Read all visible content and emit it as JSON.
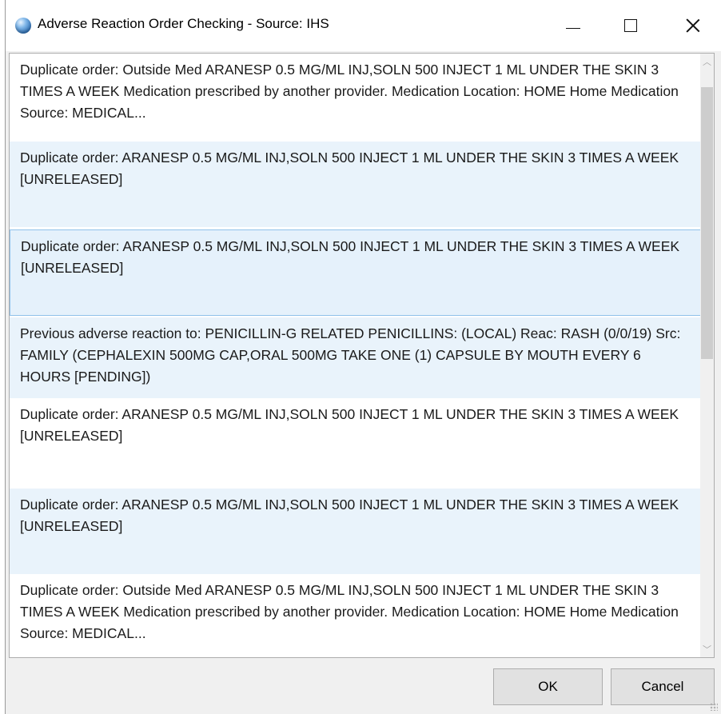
{
  "window": {
    "title": "Adverse Reaction Order Checking - Source: IHS",
    "icon": "app-globe-icon",
    "controls": {
      "minimize": "—",
      "maximize": "□",
      "close": "×"
    }
  },
  "list": {
    "items": [
      {
        "text": "Duplicate order: Outside Med ARANESP 0.5 MG/ML INJ,SOLN  500 INJECT 1 ML UNDER THE SKIN 3 TIMES A WEEK Medication prescribed by another provider. Medication Location: HOME Home Medication Source: MEDICAL...",
        "style": "normal"
      },
      {
        "text": "Duplicate order: ARANESP 0.5 MG/ML INJ,SOLN  500 INJECT 1 ML UNDER THE SKIN 3 TIMES A WEEK  [UNRELEASED]",
        "style": "alt"
      },
      {
        "text": "Duplicate order: ARANESP 0.5 MG/ML INJ,SOLN  500 INJECT 1 ML UNDER THE SKIN 3 TIMES A WEEK  [UNRELEASED]",
        "style": "selected"
      },
      {
        "text": "Previous adverse reaction to: PENICILLIN-G RELATED PENICILLINS: (LOCAL) Reac: RASH (0/0/19) Src: FAMILY (CEPHALEXIN 500MG CAP,ORAL  500MG TAKE ONE (1) CAPSULE BY MOUTH EVERY 6 HOURS  [PENDING])",
        "style": "alt"
      },
      {
        "text": "Duplicate order: ARANESP 0.5 MG/ML INJ,SOLN  500 INJECT 1 ML UNDER THE SKIN 3 TIMES A WEEK  [UNRELEASED]",
        "style": "normal"
      },
      {
        "text": "Duplicate order: ARANESP 0.5 MG/ML INJ,SOLN  500 INJECT 1 ML UNDER THE SKIN 3 TIMES A WEEK  [UNRELEASED]",
        "style": "alt"
      },
      {
        "text": "Duplicate order: Outside Med ARANESP 0.5 MG/ML INJ,SOLN  500 INJECT 1 ML UNDER THE SKIN 3 TIMES A WEEK Medication prescribed by another provider. Medication Location: HOME Home Medication Source: MEDICAL...",
        "style": "normal"
      }
    ]
  },
  "buttons": {
    "ok": "OK",
    "cancel": "Cancel"
  },
  "colors": {
    "selection_bg": "#e5f1fb",
    "selection_border": "#8fc1ea",
    "alt_row_bg": "#e9f3fb"
  }
}
